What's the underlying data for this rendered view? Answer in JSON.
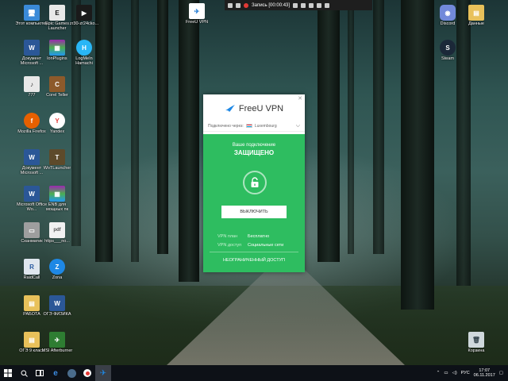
{
  "recorder": {
    "label": "Запись [00:00:43]"
  },
  "desktop_icons": [
    "Этот компьютер",
    "Epic Games Launcher",
    "zr30-zr24cko...",
    "Документ Microsoft ...",
    "lonPlugins",
    "LogMeIn Hamachi",
    "777",
    "Corel Teller",
    "Mozilla Firefox",
    "Yandex",
    "Документ Microsoft ...",
    "WoTLauncher",
    "Microsoft Office Wo...",
    "ENB для мощных пк",
    "Сканматик",
    "https___no...",
    "RaidCall",
    "Zona",
    "РАБОТА",
    "ОГЭ ФИЗИКА",
    "ОГЭ 9 класс",
    "MSI Afterburner",
    "FreeU VPN",
    "Discord",
    "Данные",
    "Steam",
    "Корзина"
  ],
  "vpn": {
    "brand": "FreeU VPN",
    "connected_via_label": "Подключено через:",
    "location": "Luxembourg",
    "subtitle": "Ваше подключение",
    "state": "ЗАЩИЩЕНО",
    "off_button": "ВЫКЛЮЧИТЬ",
    "plan_label": "VPN план",
    "plan_value": "Бесплатно",
    "access_label": "VPN доступ",
    "access_value": "Социальные сети",
    "unlimited": "НЕОГРАНИЧЕННЫЙ ДОСТУП",
    "accent": "#2ebd60"
  },
  "taskbar": {
    "lang": "РУС",
    "time": "17:07",
    "date": "06.11.2017"
  }
}
